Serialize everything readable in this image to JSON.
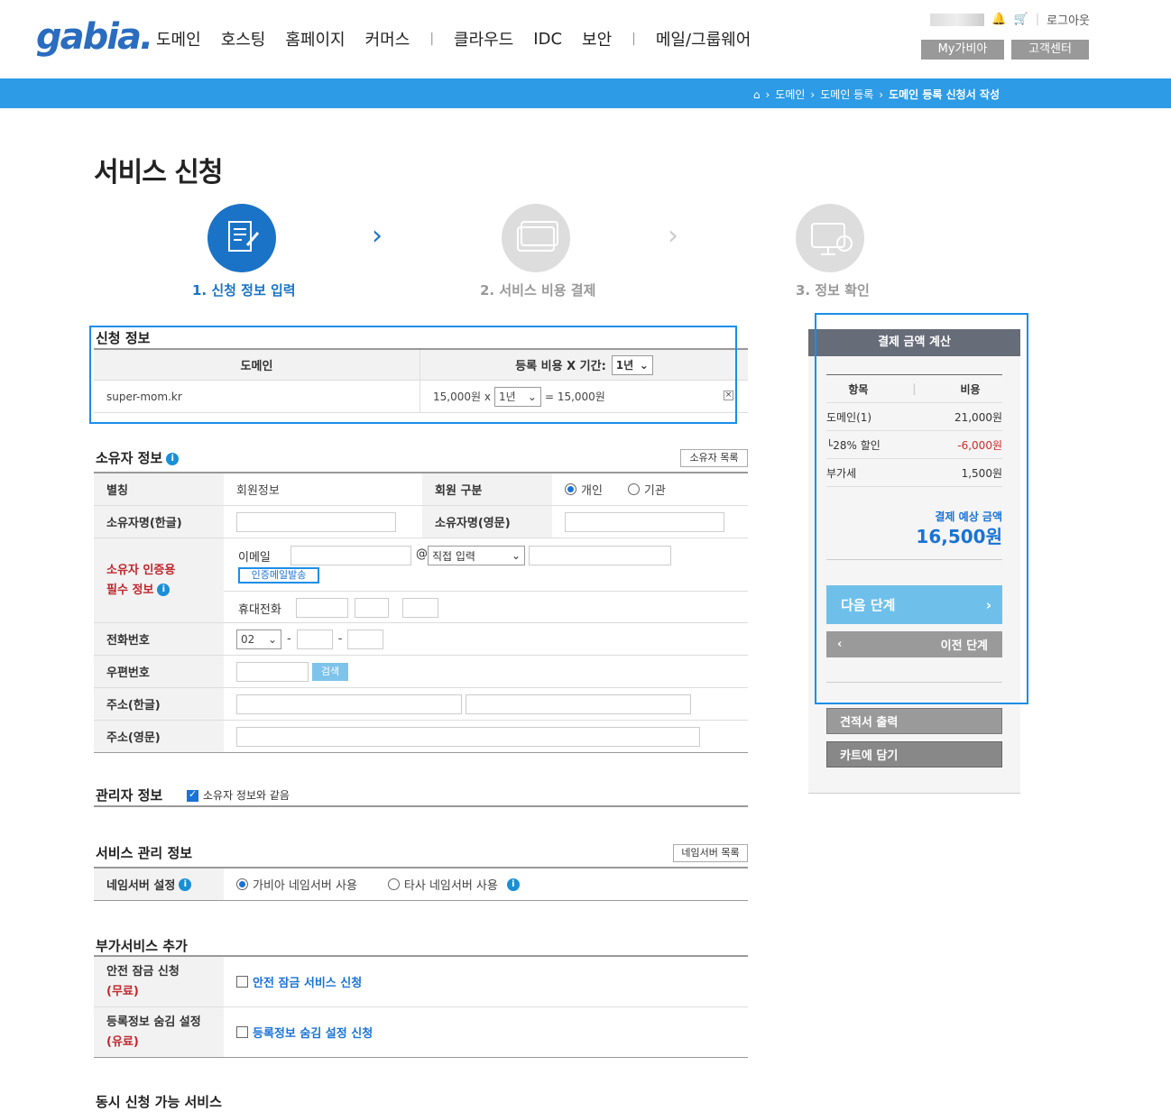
{
  "header": {
    "logo": "gabia.",
    "nav": [
      "도메인",
      "호스팅",
      "홈페이지",
      "커머스",
      "|",
      "클라우드",
      "IDC",
      "보안",
      "|",
      "메일/그룹웨어"
    ],
    "logout": "로그아웃",
    "my_btn": "My가비아",
    "cs_btn": "고객센터"
  },
  "breadcrumb": [
    "도메인",
    "도메인 등록",
    "도메인 등록 신청서 작성"
  ],
  "page_title": "서비스 신청",
  "steps": [
    "1. 신청 정보 입력",
    "2. 서비스 비용 결제",
    "3. 정보 확인"
  ],
  "apply": {
    "title": "신청 정보",
    "col_domain": "도메인",
    "col_cost": "등록 비용 X 기간:",
    "period_header": "1년",
    "domain": "super-mom.kr",
    "price": "15,000원 x",
    "period": "1년",
    "total": "= 15,000원"
  },
  "owner": {
    "title": "소유자 정보",
    "list_btn": "소유자 목록",
    "alias_label": "별칭",
    "alias_value": "회원정보",
    "member_type_label": "회원 구분",
    "member_personal": "개인",
    "member_org": "기관",
    "name_kr_label": "소유자명(한글)",
    "name_en_label": "소유자명(영문)",
    "auth_label_1": "소유자 인증용",
    "auth_label_2": "필수 정보",
    "email_label": "이메일",
    "at": "@",
    "email_domain_select": "직접 입력",
    "send_mail_btn": "인증메일발송",
    "mobile_label": "휴대전화",
    "phone_label": "전화번호",
    "phone_area": "02",
    "dash": "-",
    "zip_label": "우편번호",
    "search_btn": "검색",
    "addr_kr_label": "주소(한글)",
    "addr_en_label": "주소(영문)"
  },
  "admin": {
    "title": "관리자 정보",
    "same": "소유자 정보와 같음"
  },
  "service": {
    "title": "서비스 관리 정보",
    "ns_list_btn": "네임서버 목록",
    "ns_label": "네임서버 설정",
    "ns_gabia": "가비아 네임서버 사용",
    "ns_other": "타사 네임서버 사용"
  },
  "addon": {
    "title": "부가서비스 추가",
    "lock_label": "안전 잠금 신청",
    "lock_sub": "(무료)",
    "lock_opt": "안전 잠금 서비스 신청",
    "hide_label": "등록정보 숨김 설정",
    "hide_sub": "(유료)",
    "hide_opt": "등록정보 숨김 설정 신청"
  },
  "simultaneous": {
    "title": "동시 신청 가능 서비스"
  },
  "payment": {
    "title": "결제 금액 계산",
    "col_item": "항목",
    "col_cost": "비용",
    "rows": [
      {
        "label": "도메인(1)",
        "value": "21,000원"
      },
      {
        "label": "└28% 할인",
        "value": "-6,000원"
      },
      {
        "label": "부가세",
        "value": "1,500원"
      }
    ],
    "expected_label": "결제 예상 금액",
    "expected_value": "16,500원",
    "next": "다음 단계",
    "prev": "이전 단계",
    "quote": "견적서 출력",
    "cart": "카트에 담기"
  },
  "colors": {
    "accent": "#2d9be5",
    "primary": "#1a73d6",
    "discount": "#d42a2a"
  }
}
